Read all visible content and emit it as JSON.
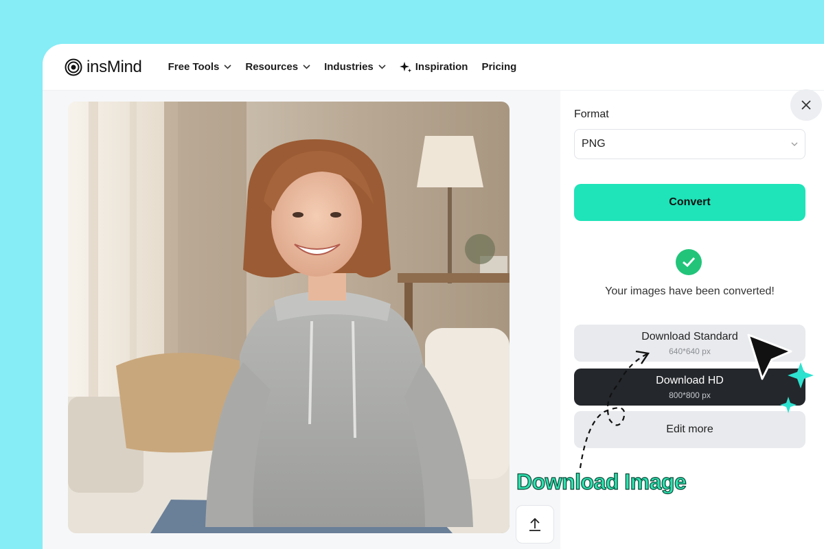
{
  "app": {
    "logo_text": "insMind"
  },
  "nav": {
    "items": [
      {
        "label": "Free Tools",
        "has_dropdown": true
      },
      {
        "label": "Resources",
        "has_dropdown": true
      },
      {
        "label": "Industries",
        "has_dropdown": true
      },
      {
        "label": "Inspiration",
        "icon": "sparkle-icon"
      },
      {
        "label": "Pricing"
      }
    ]
  },
  "panel": {
    "format_label": "Format",
    "format_value": "PNG",
    "convert_label": "Convert",
    "status_text": "Your images have been converted!",
    "download_standard": {
      "label": "Download Standard",
      "size": "640*640 px"
    },
    "download_hd": {
      "label": "Download HD",
      "size": "800*800 px"
    },
    "edit_more_label": "Edit more"
  },
  "annotation": {
    "caption": "Download Image"
  },
  "colors": {
    "background": "#86ecf6",
    "accent": "#1fe3b9",
    "success": "#22c47a",
    "dark_button": "#24272b"
  }
}
